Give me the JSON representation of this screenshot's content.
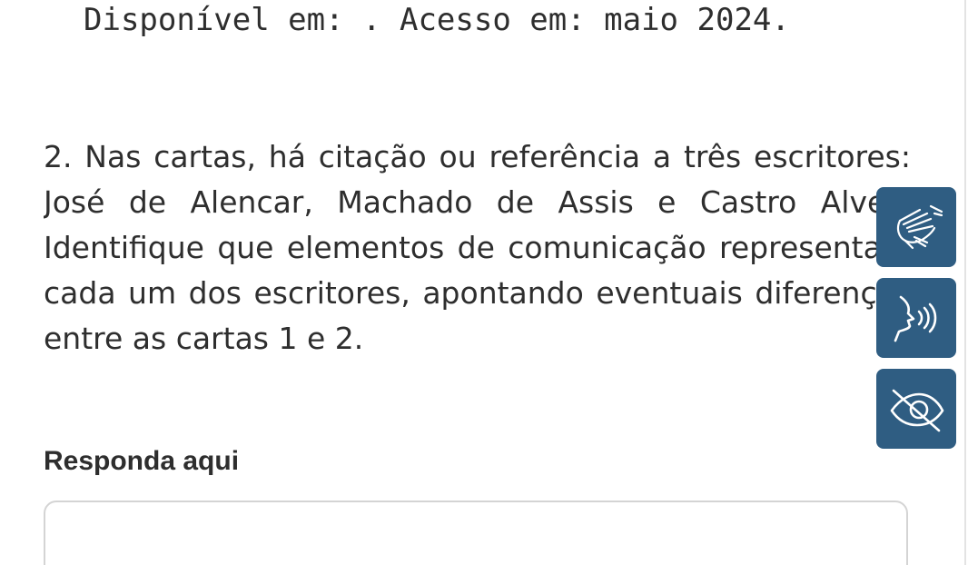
{
  "citation": {
    "text": "Disponível em: . Acesso em: maio 2024."
  },
  "question": {
    "text": "2. Nas cartas, há citação ou referência a três escritores: José de Alencar, Machado de Assis e Castro Alves. Identifique que elementos de comunicação representam cada um dos escritores, apontando eventuais diferenças entre as cartas 1 e 2."
  },
  "answer": {
    "label": "Responda aqui",
    "value": ""
  },
  "accessibility": {
    "color": "#2f5d82",
    "buttons": [
      {
        "icon": "sign-language-icon"
      },
      {
        "icon": "speaking-head-icon"
      },
      {
        "icon": "eye-slash-icon"
      }
    ]
  }
}
